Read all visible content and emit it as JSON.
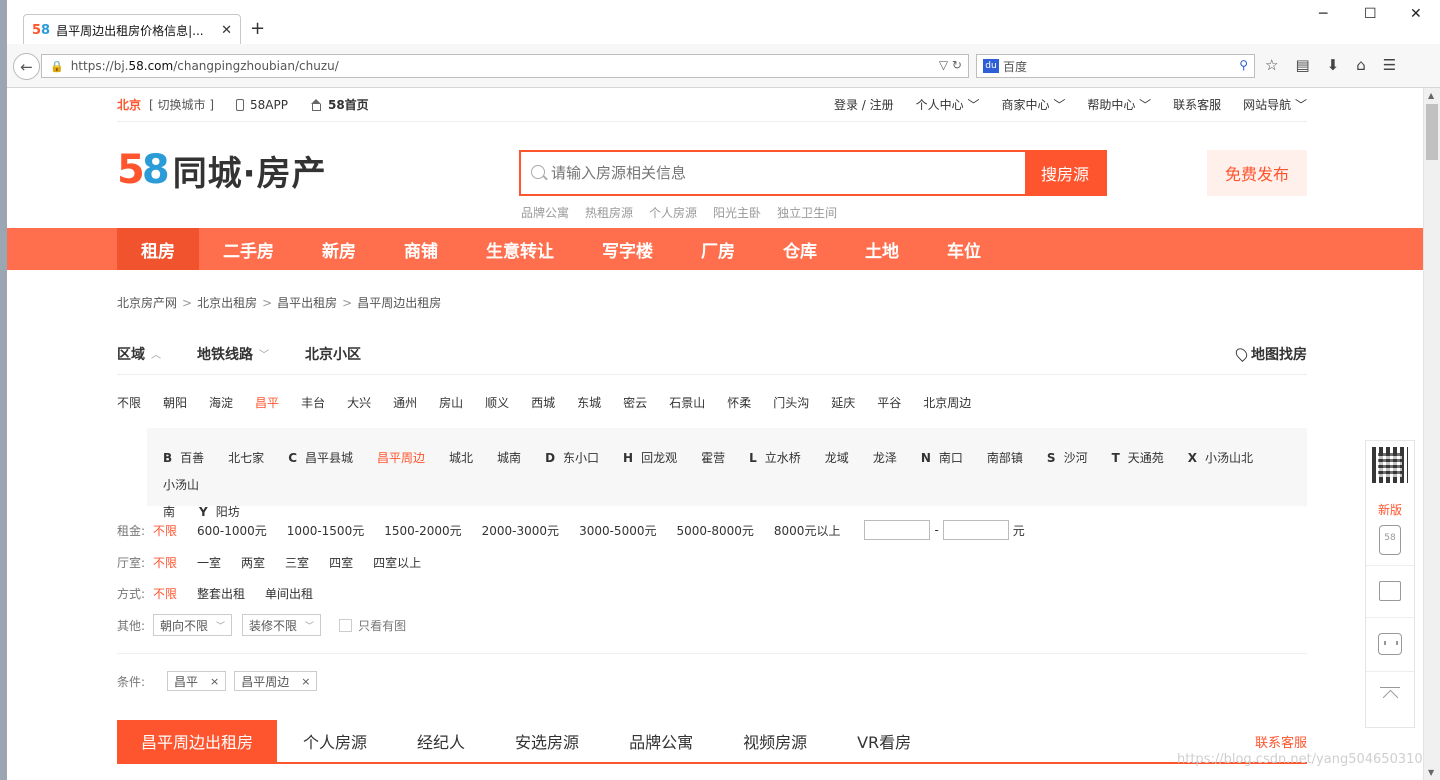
{
  "browser": {
    "tab_title": "昌平周边出租房价格信息|...",
    "tab_logo": "58",
    "url_prefix": "https://bj.",
    "url_domain": "58.com",
    "url_path": "/changpingzhoubian/chuzu/",
    "search_placeholder": "百度"
  },
  "topbar": {
    "city": "北京",
    "switch": "[ 切换城市 ]",
    "app": "58APP",
    "home": "58首页",
    "links": [
      "登录 / 注册",
      "个人中心 ﹀",
      "商家中心 ﹀",
      "帮助中心 ﹀",
      "联系客服",
      "网站导航 ﹀"
    ]
  },
  "logo": {
    "n5": "5",
    "n8": "8",
    "brand": "同城·房产"
  },
  "search": {
    "placeholder": "请输入房源相关信息",
    "button": "搜房源",
    "hot": [
      "品牌公寓",
      "热租房源",
      "个人房源",
      "阳光主卧",
      "独立卫生间"
    ]
  },
  "publish": "免费发布",
  "mainnav": [
    "租房",
    "二手房",
    "新房",
    "商铺",
    "生意转让",
    "写字楼",
    "厂房",
    "仓库",
    "土地",
    "车位"
  ],
  "breadcrumb": [
    "北京房产网",
    "北京出租房",
    "昌平出租房",
    "昌平周边出租房"
  ],
  "breadcrumb_sep": ">",
  "filter_tabs": {
    "area": "区域",
    "subway": "地铁线路",
    "community": "北京小区",
    "map": "地图找房"
  },
  "districts": [
    "不限",
    "朝阳",
    "海淀",
    "昌平",
    "丰台",
    "大兴",
    "通州",
    "房山",
    "顺义",
    "西城",
    "东城",
    "密云",
    "石景山",
    "怀柔",
    "门头沟",
    "延庆",
    "平谷",
    "北京周边"
  ],
  "sub_areas": {
    "row1": [
      {
        "letter": "B",
        "names": [
          "百善",
          "北七家"
        ]
      },
      {
        "letter": "C",
        "names": [
          "昌平县城",
          "昌平周边",
          "城北",
          "城南"
        ]
      },
      {
        "letter": "D",
        "names": [
          "东小口"
        ]
      },
      {
        "letter": "H",
        "names": [
          "回龙观",
          "霍营"
        ]
      },
      {
        "letter": "L",
        "names": [
          "立水桥",
          "龙域",
          "龙泽"
        ]
      },
      {
        "letter": "N",
        "names": [
          "南口",
          "南部镇"
        ]
      },
      {
        "letter": "S",
        "names": [
          "沙河"
        ]
      },
      {
        "letter": "T",
        "names": [
          "天通苑"
        ]
      },
      {
        "letter": "X",
        "names": [
          "小汤山北",
          "小汤山"
        ]
      }
    ],
    "row2_prefix": "南",
    "row2": [
      {
        "letter": "Y",
        "names": [
          "阳坊"
        ]
      }
    ]
  },
  "rent": {
    "label": "租金:",
    "options": [
      "不限",
      "600-1000元",
      "1000-1500元",
      "1500-2000元",
      "2000-3000元",
      "3000-5000元",
      "5000-8000元",
      "8000元以上"
    ],
    "dash": "-",
    "unit": "元"
  },
  "rooms": {
    "label": "厅室:",
    "options": [
      "不限",
      "一室",
      "两室",
      "三室",
      "四室",
      "四室以上"
    ]
  },
  "mode": {
    "label": "方式:",
    "options": [
      "不限",
      "整套出租",
      "单间出租"
    ]
  },
  "other": {
    "label": "其他:",
    "orient": "朝向不限",
    "decor": "装修不限",
    "pic": "只看有图"
  },
  "conditions": {
    "label": "条件:",
    "tags": [
      "昌平",
      "昌平周边"
    ]
  },
  "list_tabs": [
    "昌平周边出租房",
    "个人房源",
    "经纪人",
    "安选房源",
    "品牌公寓",
    "视频房源",
    "VR看房"
  ],
  "list_service": "联系客服",
  "float": {
    "new": "新版",
    "phone_label": "58"
  },
  "watermark": "https://blog.csdn.net/yang504650310",
  "colors": {
    "accent": "#ff552e",
    "nav": "#ff6f4e",
    "blue": "#2c9cd8"
  }
}
